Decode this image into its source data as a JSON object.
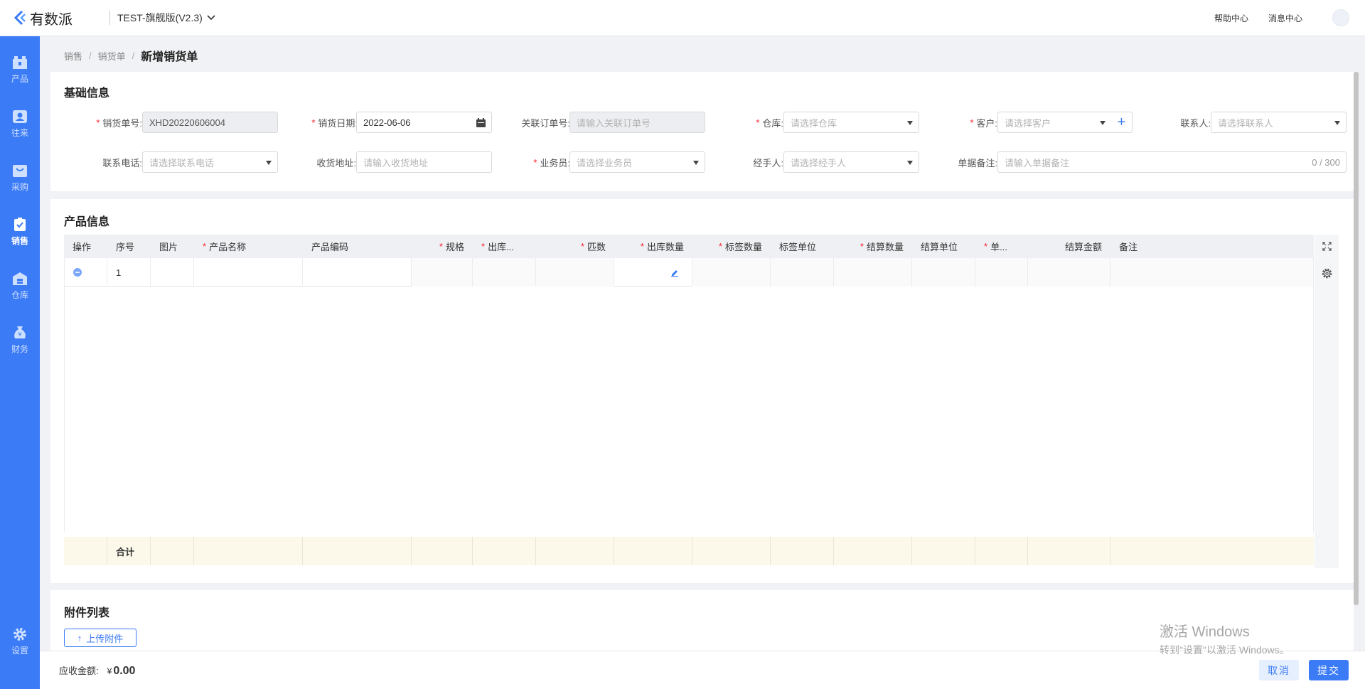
{
  "app": {
    "brand": "有数派",
    "version": "TEST-旗舰版(V2.3)",
    "help": "帮助中心",
    "messages": "消息中心"
  },
  "sidebar": {
    "items": [
      {
        "label": "产品",
        "icon": "box-icon"
      },
      {
        "label": "往来",
        "icon": "contact-icon"
      },
      {
        "label": "采购",
        "icon": "purchase-icon"
      },
      {
        "label": "销售",
        "icon": "sales-icon",
        "active": true
      },
      {
        "label": "仓库",
        "icon": "warehouse-icon"
      },
      {
        "label": "财务",
        "icon": "finance-icon"
      }
    ],
    "settings": "设置"
  },
  "breadcrumb": {
    "l1": "销售",
    "l2": "销货单",
    "current": "新增销货单"
  },
  "basic": {
    "title": "基础信息",
    "order_no_label": "销货单号:",
    "order_no_value": "XHD20220606004",
    "date_label": "销货日期:",
    "date_value": "2022-06-06",
    "ref_label": "关联订单号:",
    "ref_placeholder": "请输入关联订单号",
    "warehouse_label": "仓库:",
    "warehouse_placeholder": "请选择仓库",
    "customer_label": "客户:",
    "customer_placeholder": "请选择客户",
    "contact_label": "联系人:",
    "contact_placeholder": "请选择联系人",
    "phone_label": "联系电话:",
    "phone_placeholder": "请选择联系电话",
    "address_label": "收货地址:",
    "address_placeholder": "请输入收货地址",
    "salesman_label": "业务员:",
    "salesman_placeholder": "请选择业务员",
    "handler_label": "经手人:",
    "handler_placeholder": "请选择经手人",
    "remark_label": "单据备注:",
    "remark_placeholder": "请输入单据备注",
    "remark_count": "0 / 300"
  },
  "product": {
    "title": "产品信息",
    "columns": [
      "操作",
      "序号",
      "图片",
      "产品名称",
      "产品编码",
      "规格",
      "出库...",
      "匹数",
      "出库数量",
      "标签数量",
      "标签单位",
      "结算数量",
      "结算单位",
      "单...",
      "结算金额",
      "备注"
    ],
    "rows": [
      {
        "index": "1"
      }
    ],
    "total_label": "合计"
  },
  "attachments": {
    "title": "附件列表",
    "upload": "上传附件"
  },
  "footer": {
    "amount_label": "应收金额:",
    "currency": "¥",
    "amount": "0.00",
    "cancel": "取消",
    "submit": "提交"
  },
  "watermark": {
    "line1": "激活 Windows",
    "line2": "转到\"设置\"以激活 Windows。"
  }
}
